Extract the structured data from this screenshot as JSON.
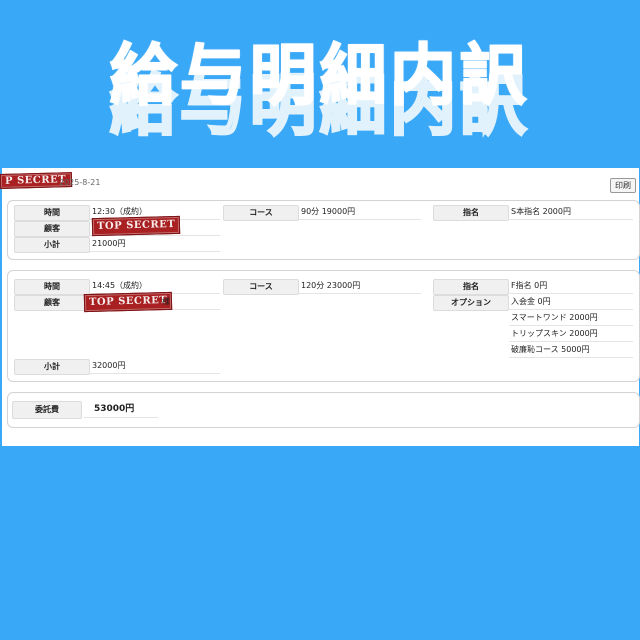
{
  "banner": {
    "title": "給与明細内訳"
  },
  "header": {
    "stamp": "P SECRET",
    "date": "2025-8-21",
    "print_label": "印刷"
  },
  "booking1": {
    "time_label": "時間",
    "time_value": "12:30（成約）",
    "customer_label": "顧客",
    "customer_stamp": "TOP SECRET",
    "subtotal_label": "小計",
    "subtotal_value": "21000円",
    "course_label": "コース",
    "course_value": "90分 19000円",
    "nomination_label": "指名",
    "nomination_value": "S本指名 2000円"
  },
  "booking2": {
    "time_label": "時間",
    "time_value": "14:45（成約）",
    "customer_label": "顧客",
    "customer_stamp": "TOP SECRET",
    "customer_suffix": "様",
    "subtotal_label": "小計",
    "subtotal_value": "32000円",
    "course_label": "コース",
    "course_value": "120分 23000円",
    "nomination_label": "指名",
    "nomination_value": "F指名 0円",
    "options_label": "オプション",
    "options": [
      "入会金 0円",
      "スマートワンド 2000円",
      "トリップスキン 2000円",
      "破廉恥コース 5000円"
    ]
  },
  "summary": {
    "fee_label": "委託費",
    "fee_value": "53000円"
  },
  "colors": {
    "background": "#39a8f7",
    "stamp": "#a82022",
    "label_bg": "#f0f0f0"
  }
}
